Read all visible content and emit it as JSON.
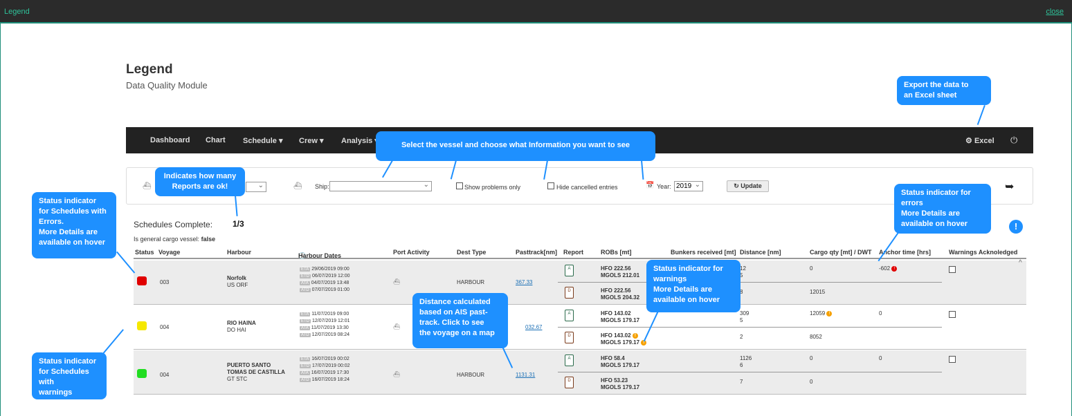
{
  "header": {
    "title": "Legend",
    "close": "close"
  },
  "page": {
    "title": "Legend",
    "subtitle": "Data Quality Module"
  },
  "nav": {
    "items": [
      "Dashboard",
      "Chart",
      "Schedule ▾",
      "Crew ▾",
      "Analysis ▾"
    ],
    "excel": "Excel",
    "power_icon": "power-icon",
    "excel_icon": "gear-icon"
  },
  "filters": {
    "ship_label": "Ship:",
    "ship_value": "",
    "show_problems": "Show problems only",
    "hide_cancelled": "Hide cancelled entries",
    "year_label": "Year:",
    "year_value": "2019",
    "update": "Update"
  },
  "summary": {
    "label": "Schedules Complete:",
    "value": "1/3",
    "gc_label": "Is general cargo vessel:",
    "gc_value": "false"
  },
  "columns": [
    "Status",
    "Voyage",
    "Harbour",
    "Harbour Dates",
    "Port Activity",
    "Dest Type",
    "Pasttrack[nm]",
    "Report",
    "ROBs [mt]",
    "Bunkers received [mt]",
    "Distance [nm]",
    "Cargo qty [mt] / DWT",
    "Anchor time [hrs]",
    "Warnings Acknoledged"
  ],
  "rows": [
    {
      "status_color": "#e00000",
      "voyage": "003",
      "harbour": "Norfolk",
      "harbour_code": "US ORF",
      "dates": [
        "29/06/2019 09:00",
        "06/07/2019 12:00",
        "04/07/2019 13:48",
        "07/07/2019 01:00"
      ],
      "tags": [
        "ETA",
        "ETD",
        "ATA",
        "ATD"
      ],
      "dest": "HARBOUR",
      "pasttrack": "367.33",
      "rob1_hfo": "HFO 222.56",
      "rob1_mgo": "MGOLS 212.01",
      "rob2_hfo": "HFO 222.56",
      "rob2_mgo": "MGOLS 204.32",
      "dist1": "12",
      "dist1b": "5",
      "dist2": "8",
      "cargo1": "0",
      "cargo2": "12015",
      "anchor": "-602"
    },
    {
      "status_color": "#f5e800",
      "voyage": "004",
      "harbour": "RIO HAINA",
      "harbour_code": "DO HAI",
      "dates": [
        "11/07/2019 09:00",
        "12/07/2019 12:01",
        "11/07/2019 13:30",
        "12/07/2019 08:24"
      ],
      "tags": [
        "ETA",
        "ETD",
        "ATA",
        "ATD"
      ],
      "dest": "",
      "pasttrack": "032.67",
      "rob1_hfo": "HFO 143.02",
      "rob1_mgo": "MGOLS 179.17",
      "rob2_hfo": "HFO 143.02",
      "rob2_mgo": "MGOLS 179.17",
      "dist1": "309",
      "dist1b": "5",
      "dist2": "2",
      "cargo1": "12059",
      "cargo2": "8052",
      "anchor": "0"
    },
    {
      "status_color": "#22dd22",
      "voyage": "004",
      "harbour": "PUERTO SANTO",
      "harbour2": "TOMAS DE CASTILLA",
      "harbour_code": "GT STC",
      "dates": [
        "16/07/2019 00:02",
        "17/07/2019 00:02",
        "16/07/2019 17:30",
        "16/07/2019 18:24"
      ],
      "tags": [
        "ETA",
        "ETD",
        "ATA",
        "ATD"
      ],
      "dest": "HARBOUR",
      "pasttrack": "1131.31",
      "rob1_hfo": "HFO 58.4",
      "rob1_mgo": "MGOLS 179.17",
      "rob2_hfo": "HFO 53.23",
      "rob2_mgo": "MGOLS 179.17",
      "dist1": "1126",
      "dist1b": "6",
      "dist2": "7",
      "cargo1": "0",
      "cargo2": "0",
      "anchor": "0"
    }
  ],
  "bubbles": {
    "export": [
      "Export the data to",
      "an Excel sheet"
    ],
    "select": [
      "Select the vessel and choose what Information you want to see"
    ],
    "reports": [
      "Indicates how many",
      "Reports are ok!"
    ],
    "status_errors": [
      "Status indicator",
      "for Schedules with",
      "Errors.",
      "More Details are",
      "available on hover"
    ],
    "status_warn_sched": [
      "Status indicator",
      "for Schedules with",
      "warnings"
    ],
    "err": [
      "Status indicator for",
      "errors",
      "More Details are",
      "available on hover"
    ],
    "warn": [
      "Status indicator for",
      "warnings",
      "More Details are",
      "available on hover"
    ],
    "distance": [
      "Distance calculated",
      "based on AIS past-",
      "track. Click to see",
      "the voyage on a map"
    ]
  },
  "colors": {
    "accent": "#1e90ff",
    "topbar": "#2b2b2b",
    "link": "#2fc29a"
  }
}
